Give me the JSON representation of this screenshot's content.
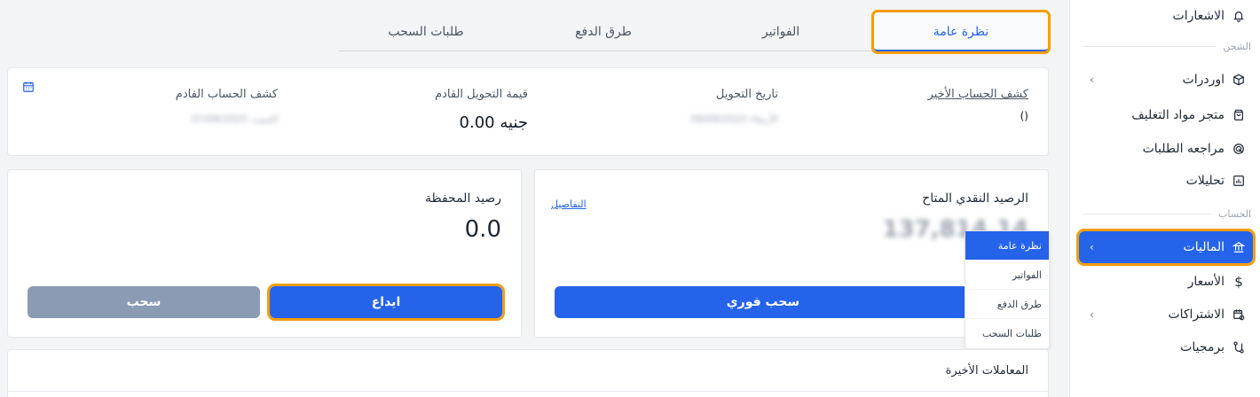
{
  "sidebar": {
    "notifications": "الاشعارات",
    "section_shipping": "الشحن",
    "orders": "اوردرات",
    "packaging_store": "متجر مواد التغليف",
    "order_review": "مراجعه الطلبات",
    "analytics": "تحليلات",
    "section_account": "الحساب",
    "finances": "الماليات",
    "prices": "الأسعار",
    "subscriptions": "الاشتراكات",
    "software": "برمجيات"
  },
  "tabs": {
    "overview": "نظرة عامة",
    "invoices": "الفواتير",
    "payment_methods": "طرق الدفع",
    "withdraw_requests": "طلبات السحب"
  },
  "summary": {
    "last_statement_label": "كشف الحساب الأخير",
    "last_statement_value": "()",
    "transfer_date_label": "تاريخ التحويل",
    "transfer_date_value": "الأربعاء 09/09/2025",
    "next_transfer_label": "قيمة التحويل القادم",
    "next_transfer_value": "0.00 جنيه",
    "next_statement_label": "كشف الحساب القادم",
    "next_statement_value": "السبت 07/09/2025"
  },
  "cash": {
    "title": "الرصيد النقدي المتاح",
    "details_link": "التفاصيل",
    "amount": "137,814.14",
    "instant_withdraw": "سحب فوري"
  },
  "wallet": {
    "title": "رصيد المحفظة",
    "amount": "0.0",
    "deposit": "ايداع",
    "withdraw": "سحب"
  },
  "dropdown": {
    "items": [
      "نظرة عامة",
      "الفواتير",
      "طرق الدفع",
      "طلبات السحب"
    ]
  },
  "recent": {
    "title": "المعاملات الأخيرة"
  }
}
